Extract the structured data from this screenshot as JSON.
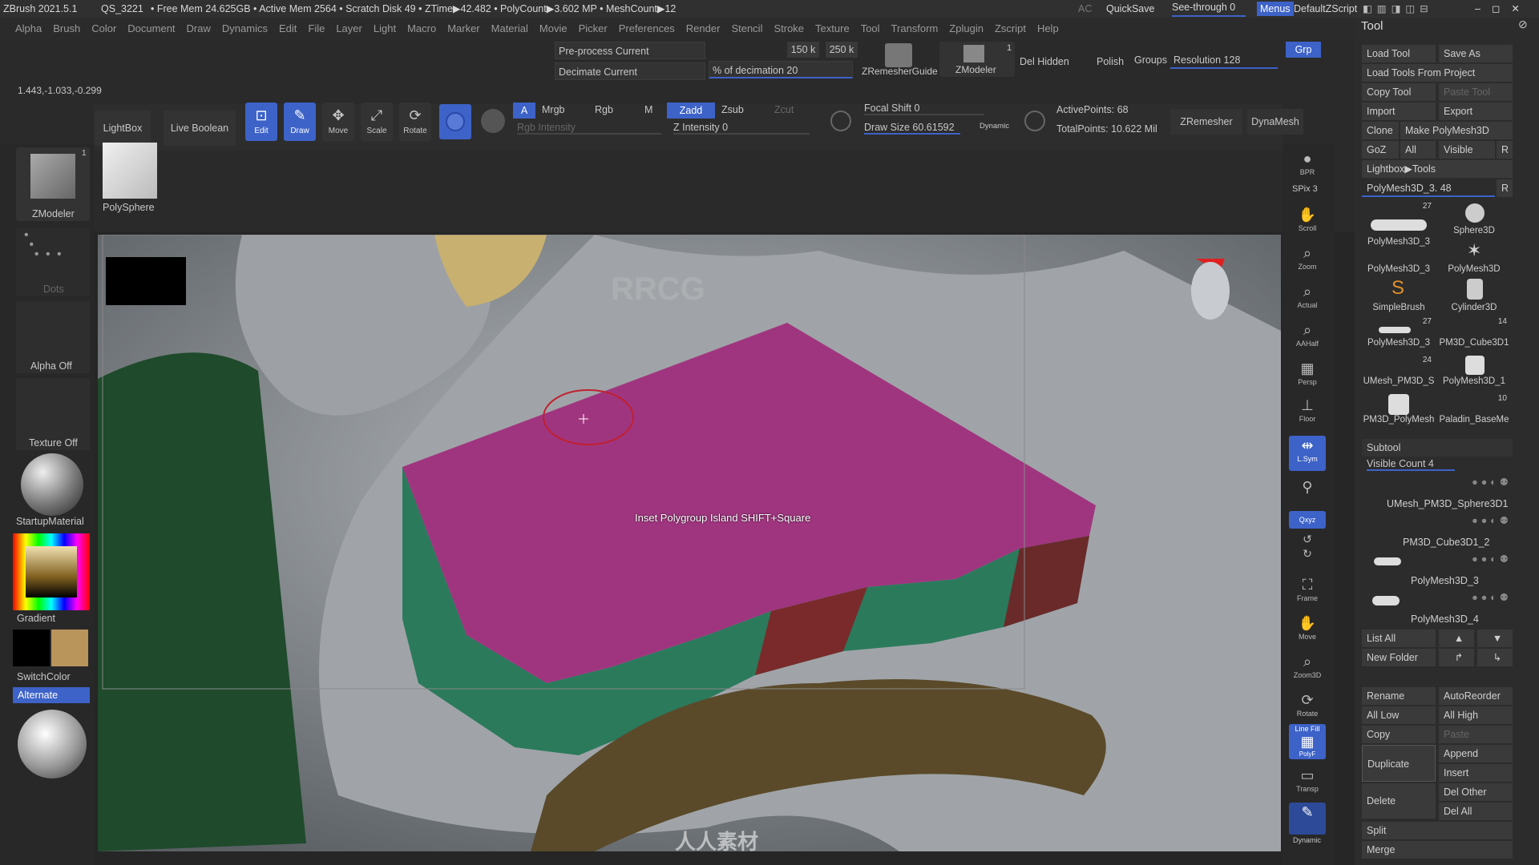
{
  "titlebar": {
    "app": "ZBrush 2021.5.1",
    "doc": "QS_3221",
    "stats": "• Free Mem 24.625GB • Active Mem 2564 • Scratch Disk 49 • ZTime▶42.482 • PolyCount▶3.602 MP • MeshCount▶12",
    "ac": "AC",
    "quicksave": "QuickSave",
    "seethrough": "See-through  0",
    "menus": "Menus",
    "zscript": "DefaultZScript"
  },
  "menubar": [
    "Alpha",
    "Brush",
    "Color",
    "Document",
    "Draw",
    "Dynamics",
    "Edit",
    "File",
    "Layer",
    "Light",
    "Macro",
    "Marker",
    "Material",
    "Movie",
    "Picker",
    "Preferences",
    "Render",
    "Stencil",
    "Stroke",
    "Texture",
    "Tool",
    "Transform",
    "Zplugin",
    "Zscript",
    "Help"
  ],
  "topbar": {
    "preprocess": "Pre-process Current",
    "decimate": "Decimate Current",
    "k150": "150 k",
    "k250": "250 k",
    "percent_decimation": "% of decimation 20",
    "zremesherguide": "ZRemesherGuide",
    "zmodeler_label": "ZModeler",
    "zmodeler_count": "1",
    "delhidden": "Del Hidden",
    "polish": "Polish",
    "groups": "Groups",
    "resolution": "Resolution 128",
    "grp": "Grp"
  },
  "coords": "1.443,-1.033,-0.299",
  "shelf": {
    "lightbox": "LightBox",
    "liveboolean": "Live Boolean",
    "edit": "Edit",
    "draw": "Draw",
    "move": "Move",
    "scale": "Scale",
    "rotate": "Rotate",
    "a": "A",
    "mrgb": "Mrgb",
    "rgb": "Rgb",
    "m": "M",
    "zadd": "Zadd",
    "zsub": "Zsub",
    "zcut": "Zcut",
    "rgb_intensity": "Rgb Intensity",
    "z_intensity": "Z Intensity 0",
    "focal_shift": "Focal Shift 0",
    "draw_size": "Draw Size 60.61592",
    "dynamic": "Dynamic",
    "active_points": "ActivePoints: 68",
    "total_points": "TotalPoints: 10.622 Mil",
    "zremesher": "ZRemesher",
    "dynamesh": "DynaMesh"
  },
  "left": {
    "tool_label": "ZModeler",
    "tool_count": "1",
    "polysphere": "PolySphere",
    "dots": "Dots",
    "alpha": "Alpha Off",
    "texture": "Texture Off",
    "material": "StartupMaterial",
    "gradient": "Gradient",
    "switchcolor": "SwitchColor",
    "alternate": "Alternate"
  },
  "right_shelf": {
    "bpr": "BPR",
    "spix": "SPix 3",
    "scroll": "Scroll",
    "zoom": "Zoom",
    "actual": "Actual",
    "aahalf": "AAHalf",
    "persp": "Persp",
    "floor": "Floor",
    "lsym": "L.Sym",
    "xyz": "Qxyz",
    "frame": "Frame",
    "move": "Move",
    "zoom3d": "Zoom3D",
    "rotate": "Rotate",
    "linefill": "Line Fill",
    "polyf": "PolyF",
    "transp": "Transp",
    "dynamic": "Dynamic"
  },
  "viewport": {
    "hint": "Inset Polygroup Island SHIFT+Square",
    "watermark": "RRCG",
    "watermark_cn": "人人素材"
  },
  "tool_panel": {
    "title": "Tool",
    "load_tool": "Load Tool",
    "save_as": "Save As",
    "load_from_project": "Load Tools From Project",
    "copy_tool": "Copy Tool",
    "paste_tool": "Paste Tool",
    "import": "Import",
    "export": "Export",
    "clone": "Clone",
    "make_polymesh": "Make PolyMesh3D",
    "goz": "GoZ",
    "all": "All",
    "visible": "Visible",
    "r": "R",
    "lightbox_tools": "Lightbox▶Tools",
    "current_tool": "PolyMesh3D_3. 48",
    "thumbs": [
      {
        "label": "PolyMesh3D_3",
        "count": "27"
      },
      {
        "label": "Sphere3D",
        "count": ""
      },
      {
        "label": "PolyMesh3D_3",
        "count": ""
      },
      {
        "label": "PolyMesh3D",
        "count": ""
      },
      {
        "label": "SimpleBrush",
        "count": ""
      },
      {
        "label": "Cylinder3D",
        "count": ""
      },
      {
        "label": "PolyMesh3D_3",
        "count": "27"
      },
      {
        "label": "PM3D_Cube3D1",
        "count": "14"
      },
      {
        "label": "UMesh_PM3D_S",
        "count": "24"
      },
      {
        "label": "PolyMesh3D_1",
        "count": ""
      },
      {
        "label": "PM3D_PolyMesh",
        "count": ""
      },
      {
        "label": "Paladin_BaseMe",
        "count": "10"
      }
    ],
    "subtool": "Subtool",
    "visible_count": "Visible Count 4",
    "subtools": [
      "UMesh_PM3D_Sphere3D1",
      "PM3D_Cube3D1_2",
      "PolyMesh3D_3",
      "PolyMesh3D_4"
    ],
    "list_all": "List All",
    "new_folder": "New Folder",
    "rename": "Rename",
    "autoreorder": "AutoReorder",
    "all_low": "All Low",
    "all_high": "All High",
    "copy": "Copy",
    "paste": "Paste",
    "duplicate": "Duplicate",
    "append": "Append",
    "insert": "Insert",
    "delete": "Delete",
    "del_other": "Del Other",
    "del_all": "Del All",
    "split": "Split",
    "merge": "Merge"
  },
  "colors": {
    "accent": "#3d62c8",
    "mesh_magenta": "#a0357f",
    "mesh_green": "#2b7a5c"
  }
}
